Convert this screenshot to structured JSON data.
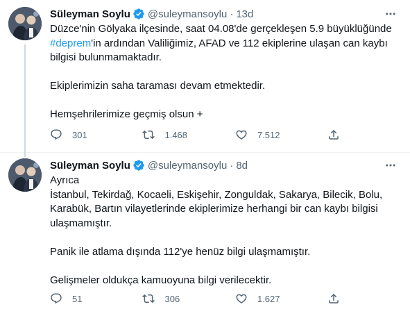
{
  "tweets": [
    {
      "author": {
        "name": "Süleyman Soylu",
        "handle": "@suleymansoylu",
        "time": "13d"
      },
      "body": {
        "line1": "Düzce'nin Gölyaka ilçesinde, saat 04.08'de gerçekleşen 5.9 büyüklüğünde",
        "hashtag": "#deprem",
        "line2_rest": "'in ardından Valiliğimiz, AFAD ve 112 ekiplerine ulaşan can kaybı",
        "line3": "bilgisi bulunmamaktadır.",
        "para2": "Ekiplerimizin saha taraması devam etmektedir.",
        "para3": "Hemşehrilerimize geçmiş olsun +"
      },
      "stats": {
        "replies": "301",
        "retweets": "1.468",
        "likes": "7.512"
      }
    },
    {
      "author": {
        "name": "Süleyman Soylu",
        "handle": "@suleymansoylu",
        "time": "8d"
      },
      "body": {
        "line1": "Ayrıca",
        "line2": "İstanbul, Tekirdağ, Kocaeli, Eskişehir, Zonguldak, Sakarya, Bilecik, Bolu,",
        "line3": "Karabük, Bartın vilayetlerinde ekiplerimize herhangi bir can kaybı bilgisi",
        "line4": "ulaşmamıştır.",
        "para2": "Panik ile atlama dışında 112'ye henüz bilgi ulaşmamıştır.",
        "para3": "Gelişmeler oldukça kamuoyuna bilgi verilecektir."
      },
      "stats": {
        "replies": "51",
        "retweets": "306",
        "likes": "1.627"
      }
    }
  ],
  "colors": {
    "text": "#0f1419",
    "secondary": "#536471",
    "accent": "#1d9bf0",
    "verified": "#1d9bf0",
    "divider": "#eff3f4"
  },
  "icons": {
    "verified": "verified-badge-icon",
    "more": "more-icon",
    "reply": "reply-icon",
    "retweet": "retweet-icon",
    "like": "like-icon",
    "share": "share-icon"
  }
}
